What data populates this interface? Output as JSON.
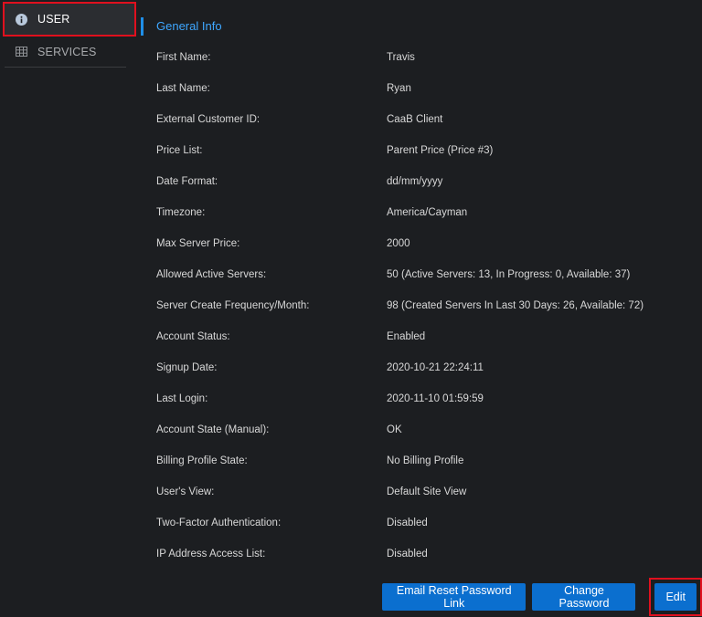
{
  "sidebar": {
    "items": [
      {
        "label": "USER",
        "icon": "info-circle-icon"
      },
      {
        "label": "SERVICES",
        "icon": "grid-table-icon"
      }
    ]
  },
  "main": {
    "section_title": "General Info",
    "rows": [
      {
        "label": "First Name:",
        "value": "Travis"
      },
      {
        "label": "Last Name:",
        "value": "Ryan"
      },
      {
        "label": "External Customer ID:",
        "value": "CaaB Client"
      },
      {
        "label": "Price List:",
        "value": "Parent Price (Price #3)"
      },
      {
        "label": "Date Format:",
        "value": "dd/mm/yyyy"
      },
      {
        "label": "Timezone:",
        "value": "America/Cayman"
      },
      {
        "label": "Max Server Price:",
        "value": "2000"
      },
      {
        "label": "Allowed Active Servers:",
        "value": "50 (Active Servers: 13, In Progress: 0, Available: 37)"
      },
      {
        "label": "Server Create Frequency/Month:",
        "value": "98 (Created Servers In Last 30 Days: 26, Available: 72)"
      },
      {
        "label": "Account Status:",
        "value": "Enabled"
      },
      {
        "label": "Signup Date:",
        "value": "2020-10-21 22:24:11"
      },
      {
        "label": "Last Login:",
        "value": "2020-11-10 01:59:59"
      },
      {
        "label": "Account State (Manual):",
        "value": "OK"
      },
      {
        "label": "Billing Profile State:",
        "value": "No Billing Profile"
      },
      {
        "label": "User's View:",
        "value": "Default Site View"
      },
      {
        "label": "Two-Factor Authentication:",
        "value": "Disabled"
      },
      {
        "label": "IP Address Access List:",
        "value": "Disabled"
      }
    ]
  },
  "buttons": {
    "email_reset": "Email Reset Password Link",
    "change_password": "Change Password",
    "edit": "Edit"
  },
  "colors": {
    "background": "#1c1e21",
    "accent": "#1f8fe8",
    "button": "#0b6fcf",
    "highlight": "#e0101e"
  }
}
